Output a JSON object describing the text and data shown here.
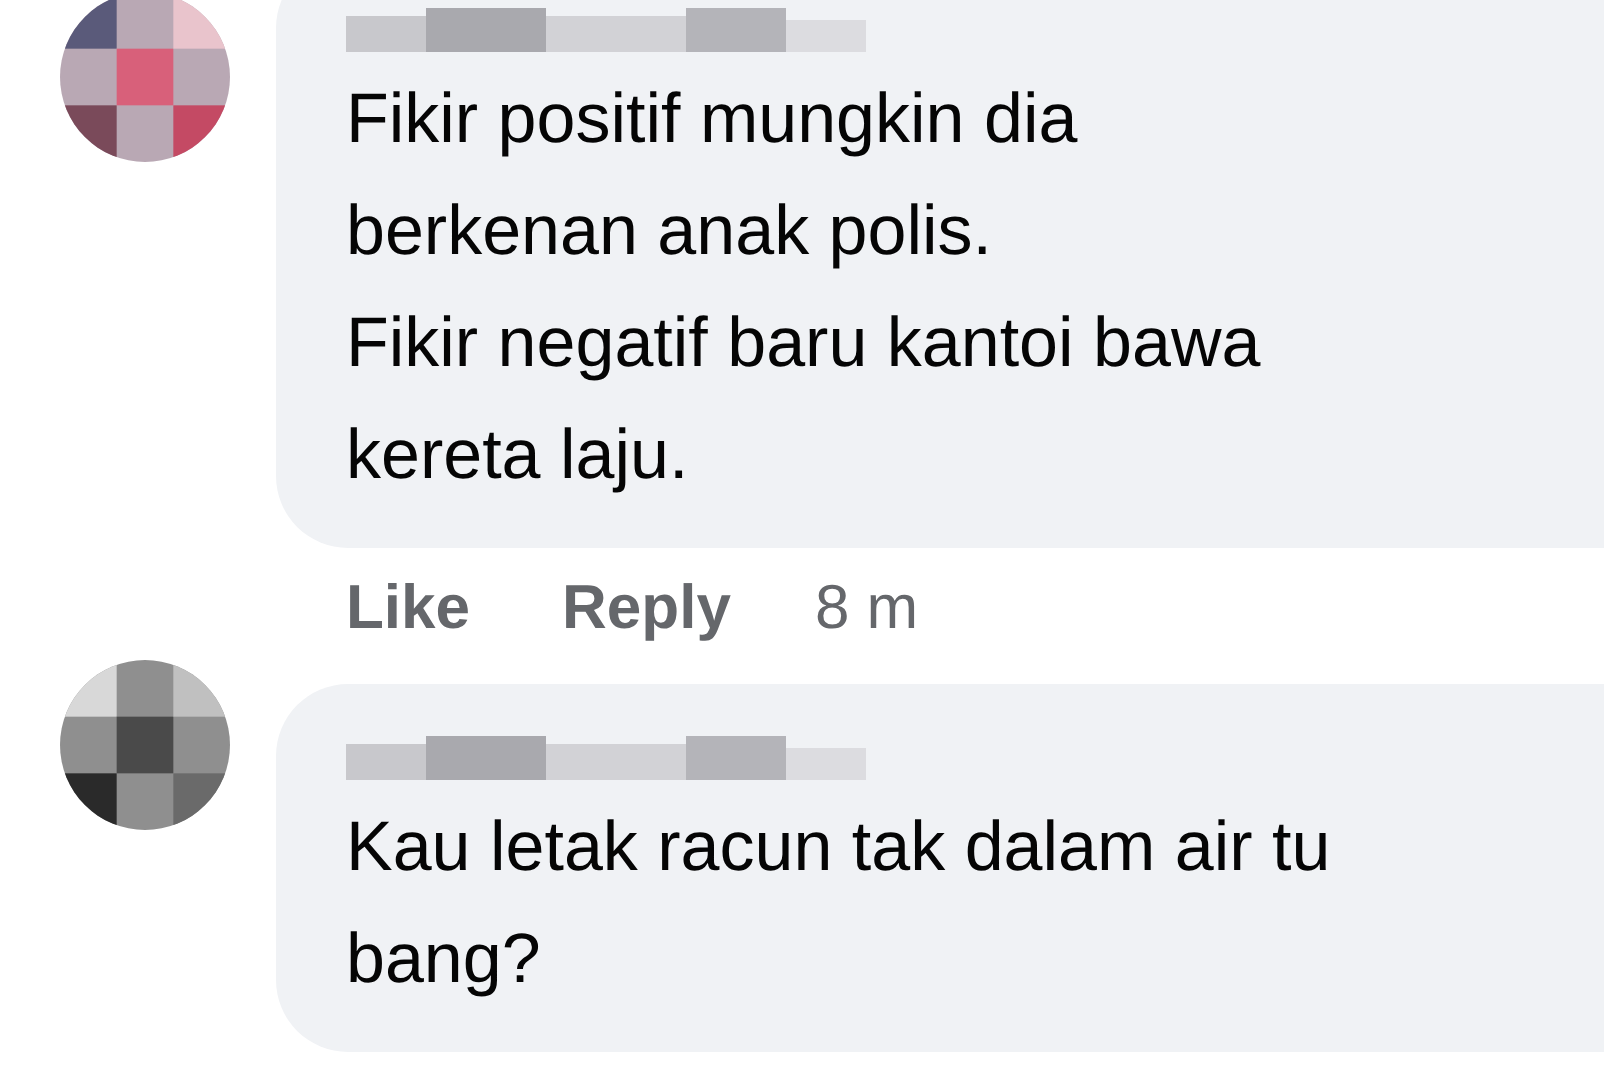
{
  "comments": [
    {
      "lines": [
        "Fikir positif mungkin dia",
        "berkenan anak polis.",
        "Fikir negatif baru kantoi bawa",
        "kereta laju."
      ],
      "actions": [
        "Like",
        "Reply"
      ],
      "time": "8 m"
    },
    {
      "lines": [
        "Kau letak racun tak dalam air tu",
        "bang?"
      ]
    }
  ]
}
